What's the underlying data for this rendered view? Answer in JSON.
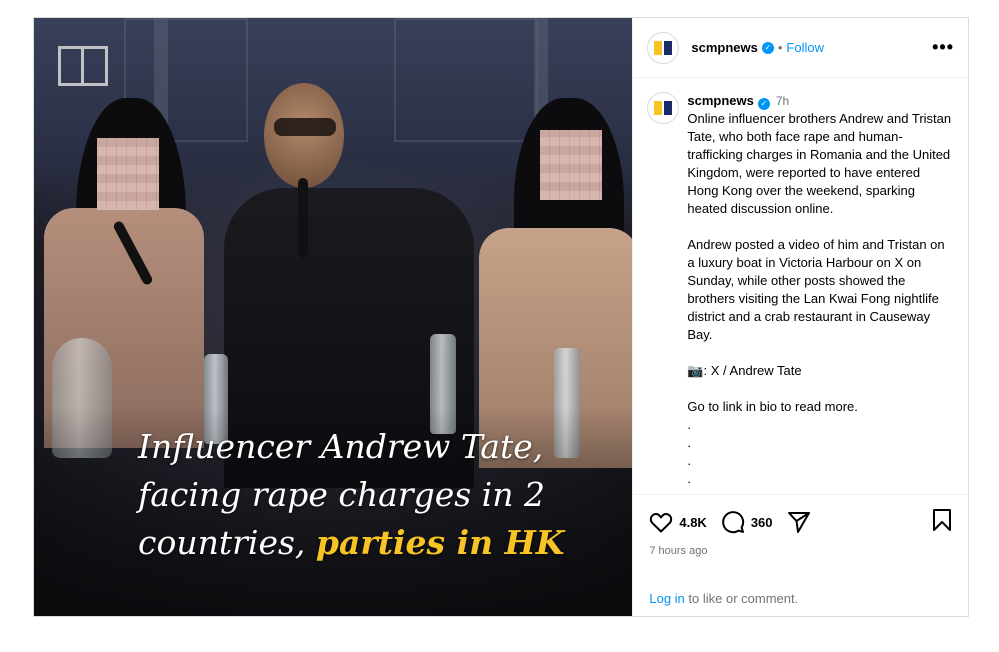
{
  "media": {
    "caption_part1": "Influencer Andrew Tate, facing rape charges in 2 countries, ",
    "caption_highlight": "parties in HK",
    "highlight_color": "#f7c325"
  },
  "header": {
    "username": "scmpnews",
    "separator": "•",
    "follow_label": "Follow",
    "more_label": "•••"
  },
  "post_caption": {
    "username": "scmpnews",
    "time": "7h",
    "paragraphs": [
      "Online influencer brothers Andrew and Tristan Tate, who both face rape and human-trafficking charges in Romania and the United Kingdom, were reported to have entered Hong Kong over the weekend, sparking heated discussion online.",
      "Andrew posted a video of him and Tristan on a luxury boat in Victoria Harbour on X on Sunday, while other posts showed the brothers visiting the Lan Kwai Fong nightlife district and a crab restaurant in Causeway Bay.",
      "📷: X / Andrew Tate",
      "Go to link in bio to read more.\n.\n.\n.\n."
    ]
  },
  "actions": {
    "likes": "4.8K",
    "comments": "360",
    "time_ago": "7 hours ago",
    "login_link": "Log in",
    "login_text": " to like or comment."
  },
  "colors": {
    "accent": "#0095f6",
    "brand_yellow": "#f7c325",
    "brand_navy": "#1b2a6b"
  }
}
